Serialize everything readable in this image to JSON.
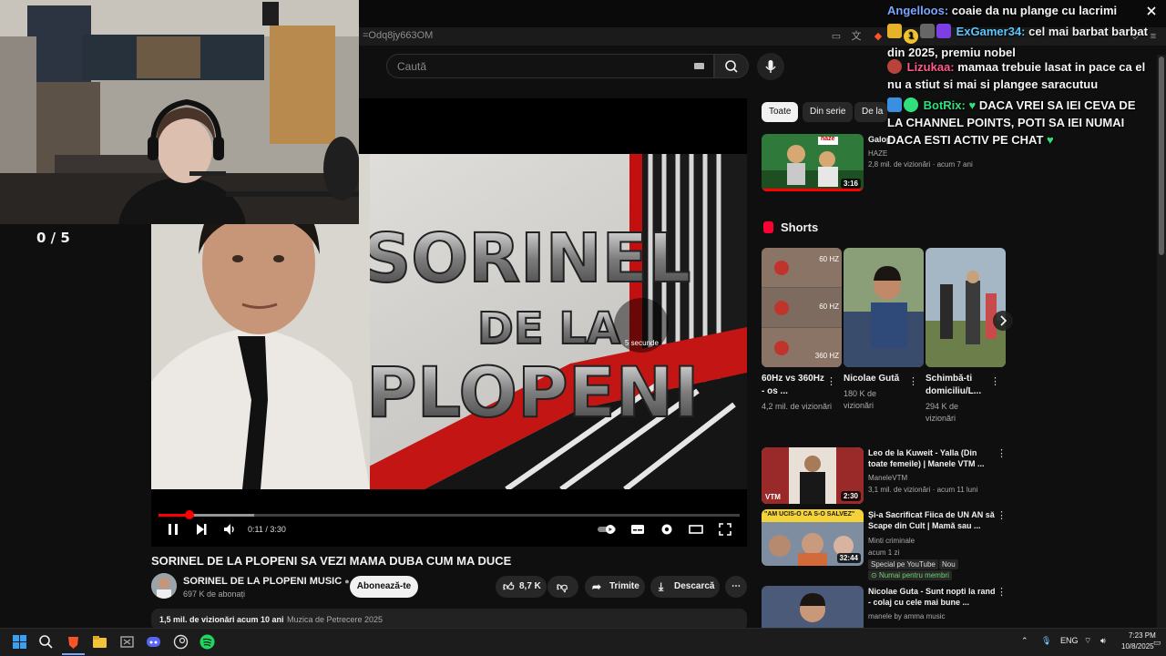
{
  "browser": {
    "url": "=Odq8jy663OM"
  },
  "header": {
    "search_placeholder": "Caută"
  },
  "overlay": {
    "score": "0  / 5"
  },
  "player": {
    "thumb_line1": "SORINEL",
    "thumb_line2": "DE LA",
    "thumb_line3": "PLOPENI",
    "skip_hint": "5 secunde",
    "time": "0:11 / 3:30",
    "progress_fraction": 0.053
  },
  "video": {
    "title": "SORINEL DE LA PLOPENI SA VEZI MAMA DUBA CUM MA DUCE",
    "channel": "SORINEL DE LA PLOPENI MUSIC",
    "subscribers": "697 K de abonați",
    "subscribe_label": "Abonează-te",
    "likes": "8,7 K",
    "share_label": "Trimite",
    "download_label": "Descarcă",
    "views": "1,5 mil. de vizionări  acum 10 ani",
    "tag": "Muzica de Petrecere 2025"
  },
  "chips": [
    "Toate",
    "Din serie",
    "De la S"
  ],
  "recommended_top": {
    "title": "Galop",
    "channel": "HAZE",
    "meta": "2,8 mil. de vizionări · acum 7 ani",
    "duration": "3:16",
    "thumb_logo": "haze"
  },
  "shorts": {
    "heading": "Shorts",
    "items": [
      {
        "title": "60Hz vs 360Hz - os ...",
        "meta": "4,2 mil. de vizionări",
        "labels": [
          "60 HZ",
          "60 HZ",
          "360 HZ"
        ]
      },
      {
        "title": "Nicolae Gută",
        "meta": "180 K de vizionări"
      },
      {
        "title": "Schimbă-ti domiciliu/L...",
        "meta": "294 K de vizionări"
      }
    ]
  },
  "recommended": [
    {
      "title": "Leo de la Kuweit - Yalla (Din toate femeile) | Manele VTM ...",
      "channel": "ManeleVTM",
      "meta": "3,1 mil. de vizionări · acum 11 luni",
      "duration": "2:30",
      "thumb_text": "VTM"
    },
    {
      "title": "Și-a Sacrificat Fiica de UN AN să Scape din Cult | Mamă sau ...",
      "channel": "Minti criminale",
      "meta": "acum 1 zi",
      "duration": "32:44",
      "thumb_text": "\"AM UCIS-O CA S-O SALVEZ\"",
      "badges": [
        "Special pe YouTube",
        "Nou"
      ],
      "members": "Numai pentru membri"
    },
    {
      "title": "Nicolae Guta - Sunt nopti la rand - colaj cu cele mai bune ...",
      "channel": "manele by amma music",
      "meta": ""
    }
  ],
  "chat": [
    {
      "user": "Angelloos:",
      "color": "#7aa6ff",
      "text": "coaie da nu plange cu lacrimi"
    },
    {
      "user": "ExGamer34:",
      "color": "#5cc8ff",
      "text": "cel mai barbat barbat din 2025, premiu nobel",
      "badge_count": "1"
    },
    {
      "user": "Lizukaa:",
      "color": "#ff5c8a",
      "text": "mamaa trebuie lasat in pace ca el nu a stiut si mai si plangee saracutuu"
    },
    {
      "user": "BotRix:",
      "color": "#2fe07b",
      "text": "DACA VREI SA IEI CEVA DE LA CHANNEL POINTS, POTI SA IEI NUMAI DACA ESTI ACTIV PE CHAT"
    }
  ],
  "taskbar": {
    "language": "ENG",
    "time": "7:23 PM",
    "date": "10/8/2025"
  },
  "colors": {
    "youtube_red": "#ff0000",
    "page_bg": "#0f0f0f"
  }
}
